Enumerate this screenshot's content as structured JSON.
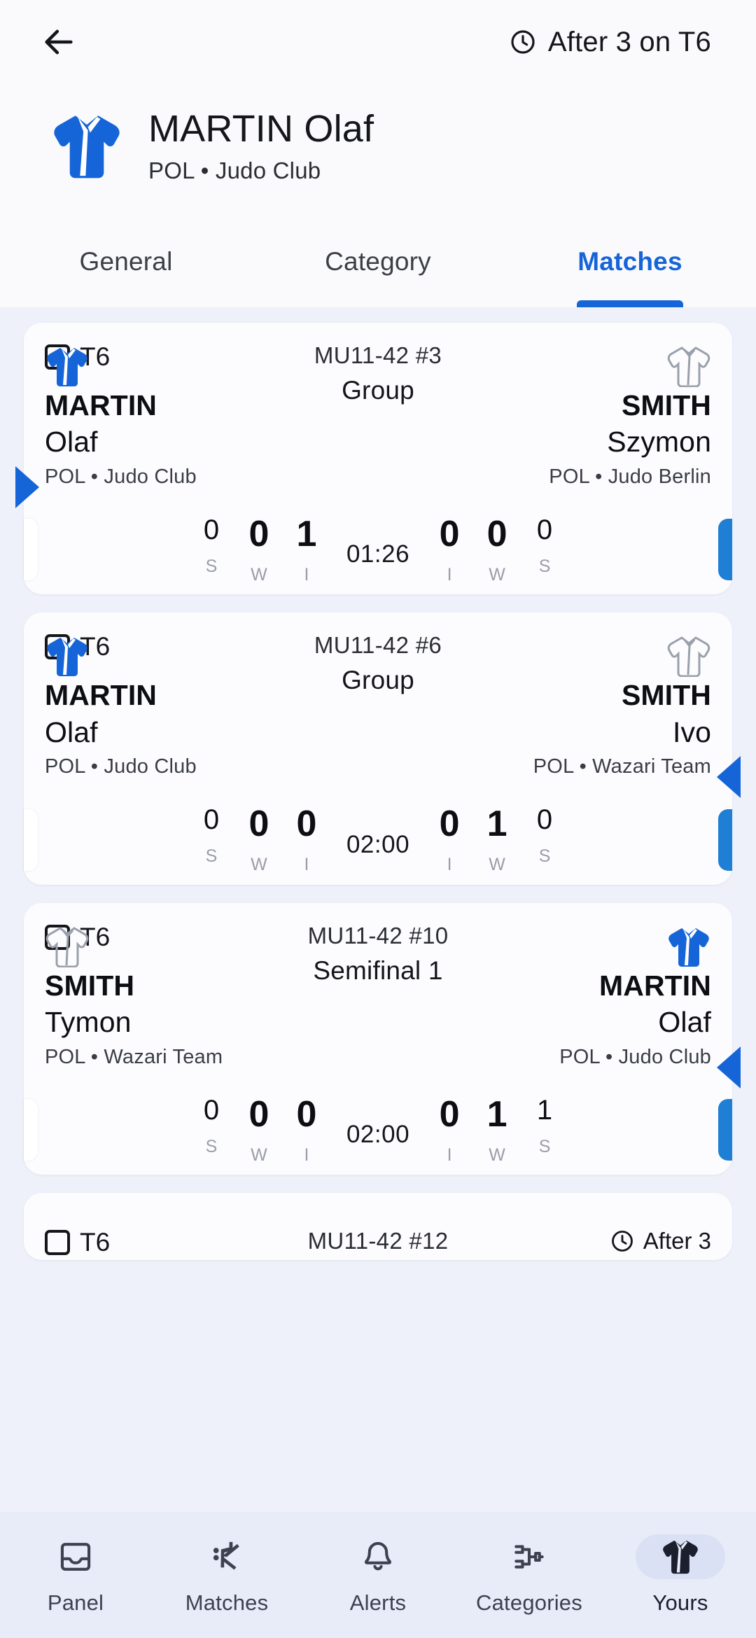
{
  "topbar": {
    "back_icon": "arrow-left-icon",
    "status_icon": "clock-icon",
    "status_text": "After 3 on T6"
  },
  "athlete": {
    "icon": "judogi-icon",
    "name": "MARTIN Olaf",
    "subtitle": "POL • Judo Club"
  },
  "tabs": [
    {
      "label": "General",
      "active": false
    },
    {
      "label": "Category",
      "active": false
    },
    {
      "label": "Matches",
      "active": true
    }
  ],
  "score_keys": {
    "left": [
      "S",
      "W",
      "I"
    ],
    "right": [
      "I",
      "W",
      "S"
    ]
  },
  "matches": [
    {
      "mat": "T6",
      "code": "MU11-42 #3",
      "round": "Group",
      "timer": "01:26",
      "winner": "left",
      "left": {
        "last": "MARTIN",
        "first": "Olaf",
        "club": "POL • Judo Club",
        "gi": "blue",
        "scores": [
          "0",
          "0",
          "1"
        ]
      },
      "right": {
        "last": "SMITH",
        "first": "Szymon",
        "club": "POL • Judo Berlin",
        "gi": "white",
        "scores": [
          "0",
          "0",
          "0"
        ]
      }
    },
    {
      "mat": "T6",
      "code": "MU11-42 #6",
      "round": "Group",
      "timer": "02:00",
      "winner": "right",
      "left": {
        "last": "MARTIN",
        "first": "Olaf",
        "club": "POL • Judo Club",
        "gi": "blue",
        "scores": [
          "0",
          "0",
          "0"
        ]
      },
      "right": {
        "last": "SMITH",
        "first": "Ivo",
        "club": "POL • Wazari Team",
        "gi": "white",
        "scores": [
          "0",
          "1",
          "0"
        ]
      }
    },
    {
      "mat": "T6",
      "code": "MU11-42 #10",
      "round": "Semifinal 1",
      "timer": "02:00",
      "winner": "right",
      "left": {
        "last": "SMITH",
        "first": "Tymon",
        "club": "POL • Wazari Team",
        "gi": "white",
        "scores": [
          "0",
          "0",
          "0"
        ]
      },
      "right": {
        "last": "MARTIN",
        "first": "Olaf",
        "club": "POL • Judo Club",
        "gi": "blue",
        "scores": [
          "0",
          "1",
          "1"
        ]
      }
    }
  ],
  "partial_match": {
    "mat": "T6",
    "code": "MU11-42 #12",
    "status_icon": "clock-icon",
    "status_text": "After 3"
  },
  "bottomnav": [
    {
      "label": "Panel",
      "icon": "inbox-icon",
      "active": false
    },
    {
      "label": "Matches",
      "icon": "judo-throw-icon",
      "active": false
    },
    {
      "label": "Alerts",
      "icon": "bell-icon",
      "active": false
    },
    {
      "label": "Categories",
      "icon": "bracket-icon",
      "active": false
    },
    {
      "label": "Yours",
      "icon": "judogi-icon",
      "active": true
    }
  ],
  "colors": {
    "accent": "#1565d8",
    "blue_gi": "#1565d8",
    "white_gi": "#9aa0ab",
    "nav_bg": "#e8ecf8",
    "list_bg": "#eef1f9"
  }
}
